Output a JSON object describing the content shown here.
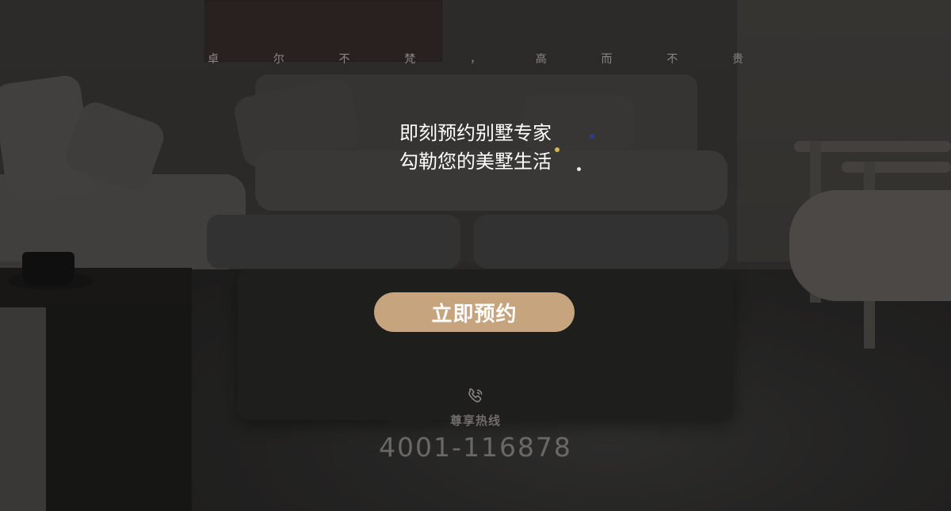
{
  "slogan": [
    "卓",
    "尔",
    "不",
    "梵",
    "，",
    "高",
    "而",
    "不",
    "贵"
  ],
  "headline": {
    "line1": "即刻预约别墅专家",
    "line2": "勾勒您的美墅生活"
  },
  "form": {
    "name_value": "",
    "phone_value": ""
  },
  "submit_label": "立即预约",
  "hotline": {
    "icon": "phone-icon",
    "label": "尊享热线",
    "number": "4001-116878"
  },
  "colors": {
    "accent": "#c6a47d",
    "field_bg": "#323232",
    "headline": "#ffffff"
  }
}
